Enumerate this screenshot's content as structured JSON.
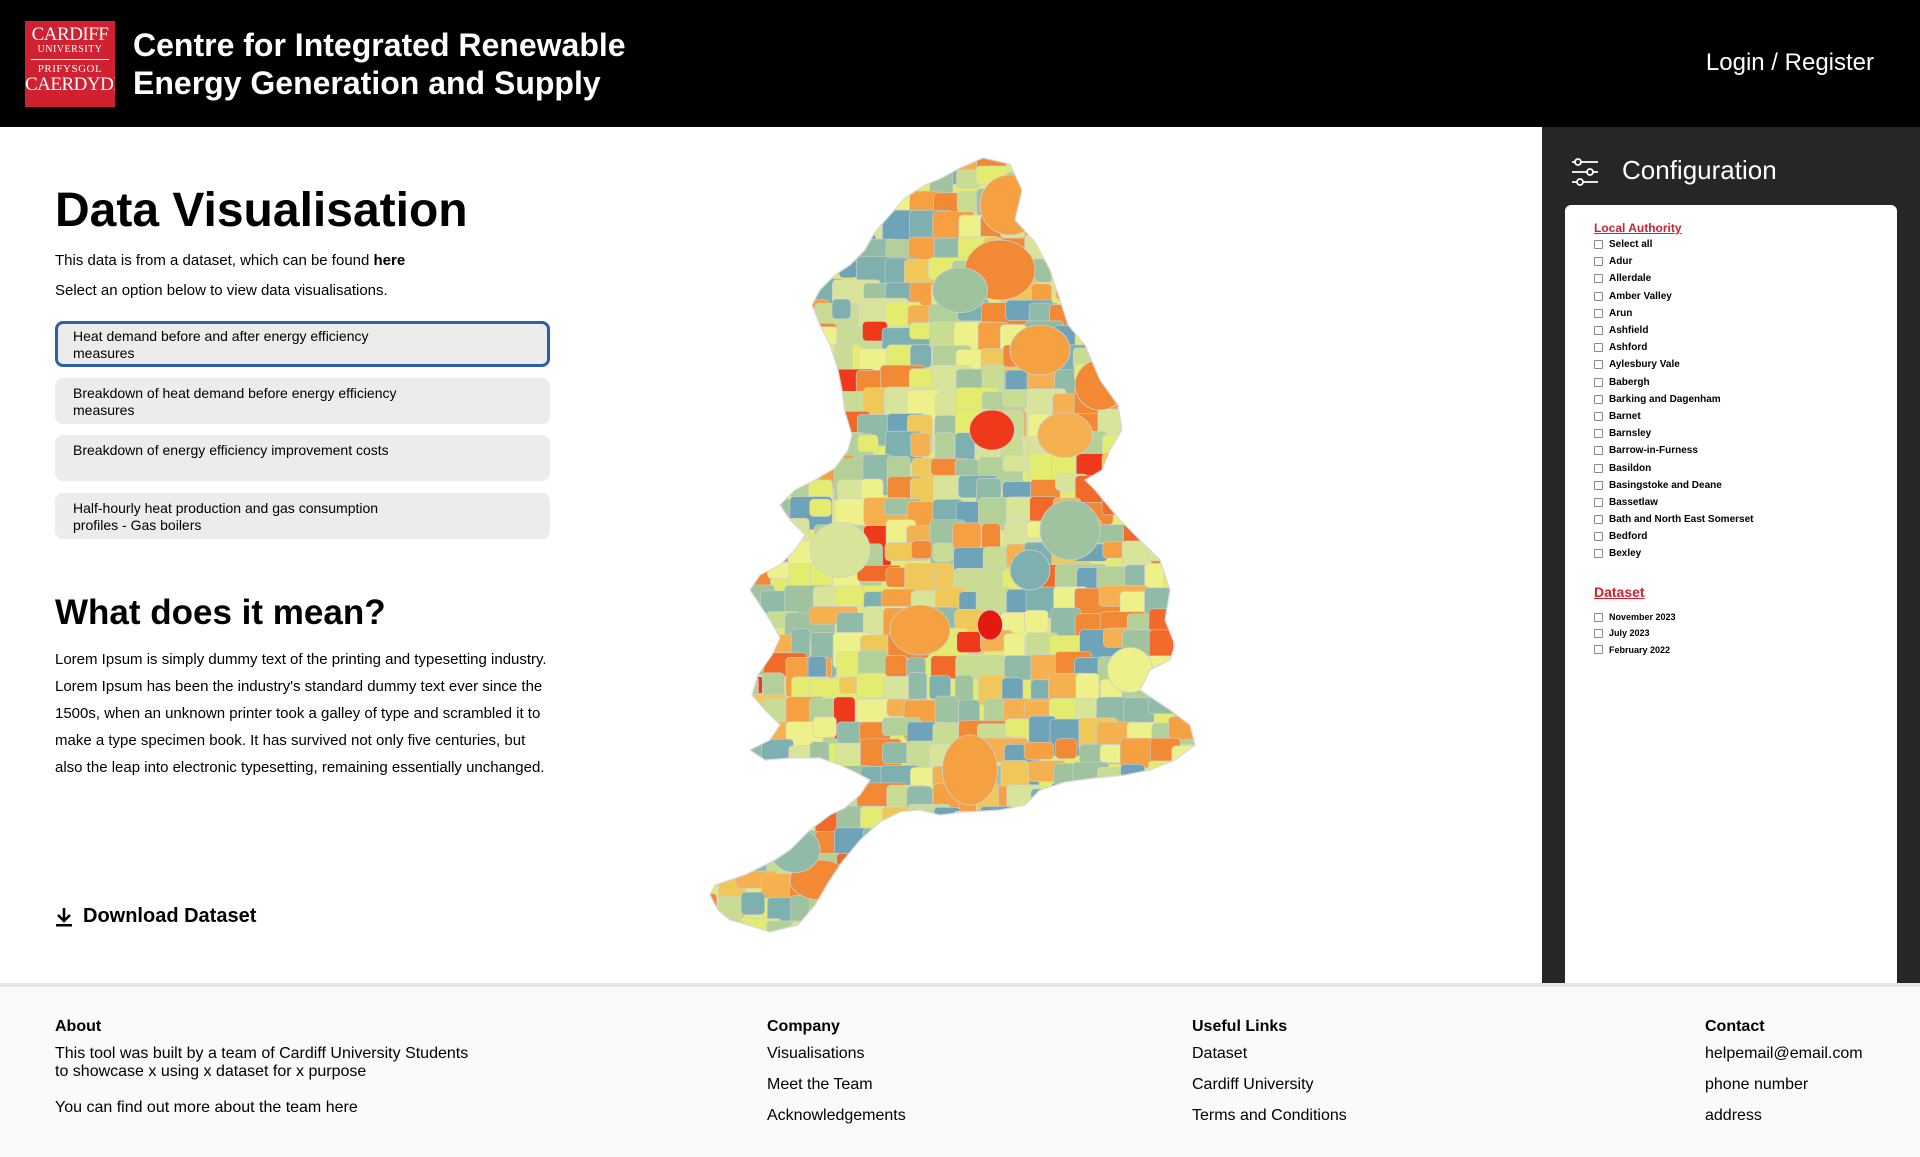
{
  "header": {
    "logo": {
      "line1": "CARDIFF",
      "line2": "UNIVERSITY",
      "line3": "PRIFYSGOL",
      "line4": "CAERDYDD"
    },
    "title": "Centre for Integrated Renewable\nEnergy Generation and Supply",
    "login": "Login / Register"
  },
  "main": {
    "title": "Data Visualisation",
    "intro_prefix": "This data is from a dataset, which can be found ",
    "intro_link": "here",
    "intro2": "Select an option below to view data visualisations.",
    "options": [
      {
        "label": "Heat demand before and after energy efficiency measures",
        "selected": true
      },
      {
        "label": "Breakdown of heat demand before energy efficiency measures",
        "selected": false
      },
      {
        "label": "Breakdown of energy efficiency improvement costs",
        "selected": false
      },
      {
        "label": "Half-hourly heat production and gas consumption profiles - Gas boilers",
        "selected": false
      }
    ],
    "meaning_title": "What does it mean?",
    "meaning_text": "Lorem Ipsum is simply dummy text of the printing and typesetting industry. Lorem Ipsum has been the industry's standard dummy text ever since the 1500s, when an unknown printer took a galley of type and scrambled it to make a type specimen book. It has survived not only five centuries, but also the leap into electronic typesetting, remaining essentially unchanged.",
    "download": "Download Dataset"
  },
  "map": {
    "palette": [
      "#eef08a",
      "#e3ec6e",
      "#d8e49a",
      "#c9dc94",
      "#b3d098",
      "#9ec39e",
      "#8fbba8",
      "#7eb0b0",
      "#6fa3b8",
      "#f0c85a",
      "#f5b04f",
      "#f5a142",
      "#f28a35",
      "#f26a2a",
      "#ee3a1a",
      "#e31a10"
    ]
  },
  "config": {
    "title": "Configuration",
    "local_authority_title": "Local Authority",
    "local_authorities": [
      "Select all",
      "Adur",
      "Allerdale",
      "Amber Valley",
      "Arun",
      "Ashfield",
      "Ashford",
      "Aylesbury Vale",
      "Babergh",
      "Barking and Dagenham",
      "Barnet",
      "Barnsley",
      "Barrow-in-Furness",
      "Basildon",
      "Basingstoke and Deane",
      "Bassetlaw",
      "Bath and North East Somerset",
      "Bedford",
      "Bexley"
    ],
    "dataset_title": "Dataset",
    "datasets": [
      "November 2023",
      "July 2023",
      "February 2022"
    ]
  },
  "footer": {
    "about": {
      "title": "About",
      "line1": "This tool was built by a team of Cardiff University Students",
      "line2": "to showcase x using x dataset for x purpose",
      "line3": "You can find out more about the team here"
    },
    "company": {
      "title": "Company",
      "links": [
        "Visualisations",
        "Meet the Team",
        "Acknowledgements"
      ]
    },
    "useful": {
      "title": "Useful Links",
      "links": [
        "Dataset",
        "Cardiff University",
        "Terms and Conditions"
      ]
    },
    "contact": {
      "title": "Contact",
      "links": [
        "helpemail@email.com",
        "phone number",
        "address"
      ]
    }
  }
}
